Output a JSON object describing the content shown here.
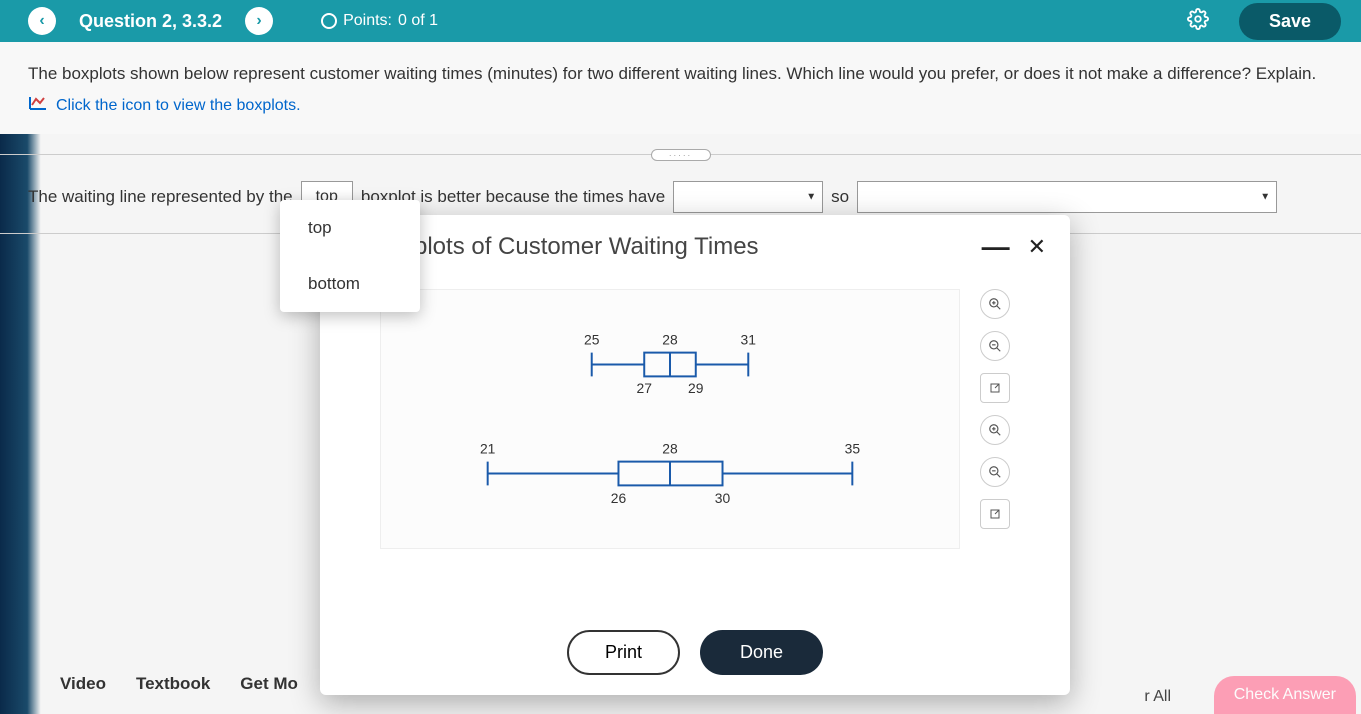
{
  "header": {
    "question_label": "Question 2, 3.3.2",
    "points_label": "Points:",
    "points_value": "0 of 1",
    "save": "Save"
  },
  "question": {
    "text": "The boxplots shown below represent customer waiting times (minutes) for two different waiting lines. Which line would you prefer, or does it not make a difference? Explain.",
    "link": "Click the icon to view the boxplots."
  },
  "answer": {
    "part1": "The waiting line represented by the",
    "dropdown1_value": "top",
    "part2": "boxplot is better because the times have",
    "so": "so",
    "options": [
      "top",
      "bottom"
    ]
  },
  "modal": {
    "title": "plots of Customer Waiting Times",
    "print": "Print",
    "done": "Done"
  },
  "chart_data": [
    {
      "type": "boxplot",
      "name": "top",
      "min": 25,
      "q1": 27,
      "median": 28,
      "q3": 29,
      "max": 31,
      "labels_above": {
        "min": "25",
        "median": "28",
        "max": "31"
      },
      "labels_below": {
        "q1": "27",
        "q3": "29"
      }
    },
    {
      "type": "boxplot",
      "name": "bottom",
      "min": 21,
      "q1": 26,
      "median": 28,
      "q3": 30,
      "max": 35,
      "labels_above": {
        "min": "21",
        "median": "28",
        "max": "35"
      },
      "labels_below": {
        "q1": "26",
        "q3": "30"
      }
    }
  ],
  "chart_axis": {
    "xmin": 20,
    "xmax": 36
  },
  "bottom": {
    "video": "Video",
    "textbook": "Textbook",
    "getmore": "Get Mo",
    "rall": "r All",
    "check": "Check Answer"
  }
}
